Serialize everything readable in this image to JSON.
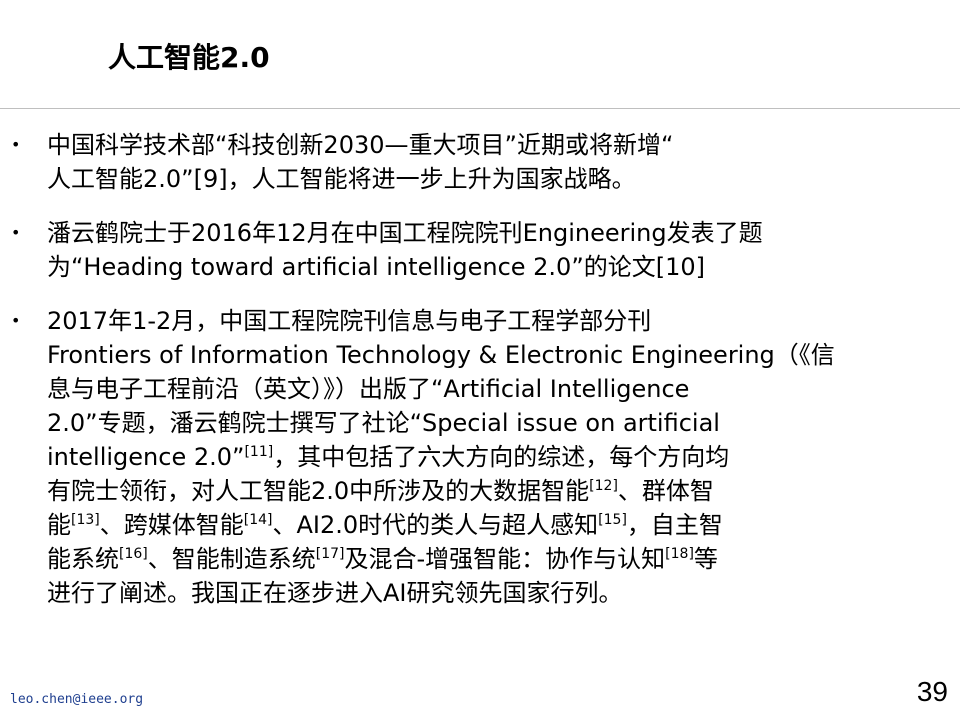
{
  "slide": {
    "title": "人工智能2.0",
    "page_number": "39",
    "footer_email": "leo.chen@ieee.org"
  },
  "bullets": [
    {
      "marker": "•",
      "lines": [
        "中国科学技术部“科技创新2030—重大项目”近期或将新增“",
        "人工智能2.0”[9]，人工智能将进一步上升为国家战略。"
      ]
    },
    {
      "marker": "•",
      "lines": [
        "潘云鹤院士于2016年12月在中国工程院院刊Engineering发表了题",
        "为“Heading toward artificial intelligence 2.0”的论文[10]"
      ]
    },
    {
      "marker": "•",
      "line1": "2017年1-2月，中国工程院院刊信息与电子工程学部分刊",
      "line2": "Frontiers of Information Technology & Electronic Engineering（《信",
      "line3": "息与电子工程前沿（英文）》）出版了“Artificial Intelligence",
      "line4": "2.0”专题，潘云鹤院士撰写了社论“Special issue on artificial",
      "line5_a": "intelligence 2.0”",
      "ref11": "[11]",
      "line5_b": "，其中包括了六大方向的综述，每个方向均",
      "line6_a": "有院士领衔，对人工智能2.0中所涉及的大数据智能",
      "ref12": "[12]",
      "line6_b": "、群体智",
      "line7_a": "能",
      "ref13": "[13]",
      "line7_b": "、跨媒体智能",
      "ref14": "[14]",
      "line7_c": "、AI2.0时代的类人与超人感知",
      "ref15": "[15]",
      "line7_d": "，自主智",
      "line8_a": "能系统",
      "ref16": "[16]",
      "line8_b": "、智能制造系统",
      "ref17": "[17]",
      "line8_c": "及混合-增强智能：协作与认知",
      "ref18": "[18]",
      "line8_d": "等",
      "line9": "进行了阐述。我国正在逐步进入AI研究领先国家行列。"
    }
  ]
}
